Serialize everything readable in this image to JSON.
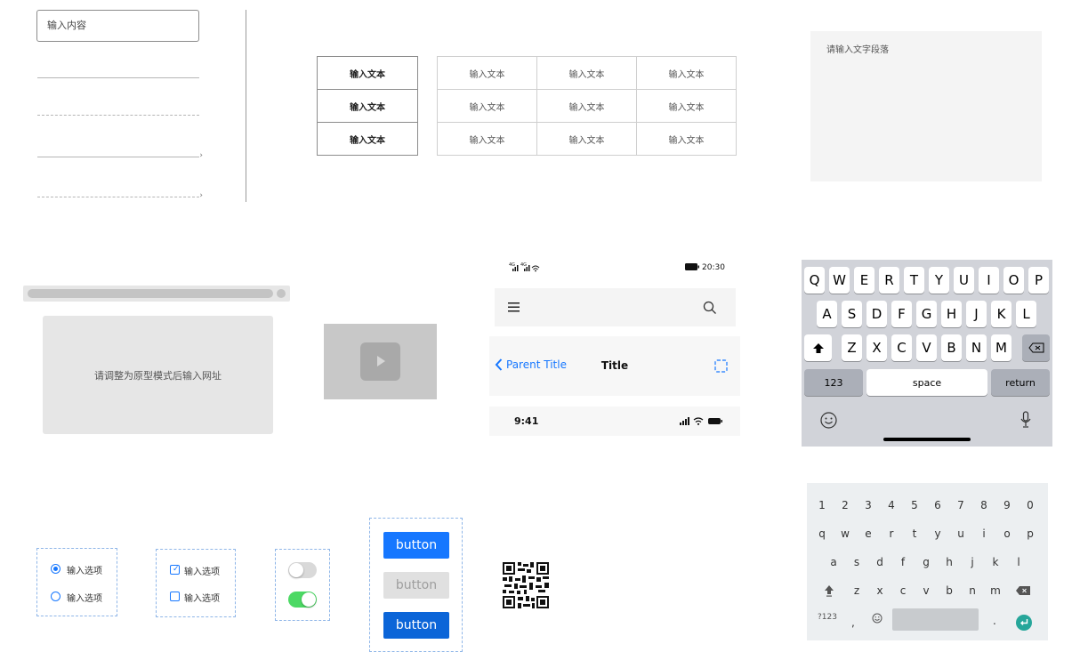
{
  "input": {
    "placeholder": "输入内容"
  },
  "table_simple": {
    "rows": [
      "输入文本",
      "输入文本",
      "输入文本"
    ]
  },
  "table_grid": {
    "rows": [
      [
        "输入文本",
        "输入文本",
        "输入文本"
      ],
      [
        "输入文本",
        "输入文本",
        "输入文本"
      ],
      [
        "输入文本",
        "输入文本",
        "输入文本"
      ]
    ]
  },
  "textarea": {
    "placeholder": "请输入文字段落"
  },
  "webframe": {
    "text": "请调整为原型模式后输入网址"
  },
  "status_bar_android": {
    "time": "20:30"
  },
  "nav_bar": {
    "back_label": "Parent Title",
    "title": "Title"
  },
  "status_bar_ios": {
    "time": "9:41"
  },
  "ios_keyboard": {
    "row1": [
      "Q",
      "W",
      "E",
      "R",
      "T",
      "Y",
      "U",
      "I",
      "O",
      "P"
    ],
    "row2": [
      "A",
      "S",
      "D",
      "F",
      "G",
      "H",
      "J",
      "K",
      "L"
    ],
    "row3": [
      "Z",
      "X",
      "C",
      "V",
      "B",
      "N",
      "M"
    ],
    "numbers_label": "123",
    "space_label": "space",
    "return_label": "return"
  },
  "android_keyboard": {
    "digits": [
      "1",
      "2",
      "3",
      "4",
      "5",
      "6",
      "7",
      "8",
      "9",
      "0"
    ],
    "row1": [
      "q",
      "w",
      "e",
      "r",
      "t",
      "y",
      "u",
      "i",
      "o",
      "p"
    ],
    "row2": [
      "a",
      "s",
      "d",
      "f",
      "g",
      "h",
      "j",
      "k",
      "l"
    ],
    "row3": [
      "z",
      "x",
      "c",
      "v",
      "b",
      "n",
      "m"
    ],
    "symbols_label": "?123",
    "comma": ",",
    "period": "."
  },
  "radio_group": {
    "options": [
      "输入选项",
      "输入选项"
    ],
    "selected": 0
  },
  "checkbox_group": {
    "options": [
      "输入选项",
      "输入选项"
    ],
    "checked": [
      true,
      false
    ]
  },
  "switch_group": {
    "states": [
      false,
      true
    ]
  },
  "buttons": {
    "labels": [
      "button",
      "button",
      "button"
    ]
  },
  "colors": {
    "primary": "#1677ff",
    "switch_on": "#4cd964",
    "disabled_button": "#e0e0e0",
    "pressed_button": "#0b65d8"
  }
}
